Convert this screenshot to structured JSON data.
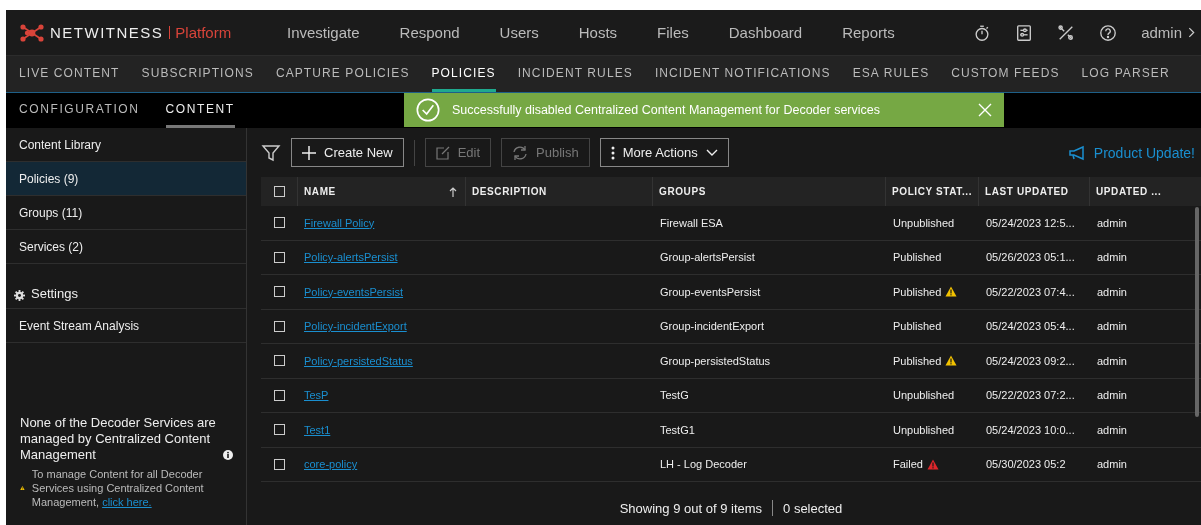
{
  "brand": {
    "name": "NETWITNESS",
    "product": "Platform"
  },
  "nav": [
    {
      "label": "Investigate"
    },
    {
      "label": "Respond"
    },
    {
      "label": "Users"
    },
    {
      "label": "Hosts"
    },
    {
      "label": "Files"
    },
    {
      "label": "Dashboard"
    },
    {
      "label": "Reports"
    }
  ],
  "user": "admin",
  "subnav": [
    {
      "label": "LIVE CONTENT",
      "selected": false
    },
    {
      "label": "SUBSCRIPTIONS",
      "selected": false
    },
    {
      "label": "CAPTURE POLICIES",
      "selected": false
    },
    {
      "label": "POLICIES",
      "selected": true
    },
    {
      "label": "INCIDENT RULES",
      "selected": false
    },
    {
      "label": "INCIDENT NOTIFICATIONS",
      "selected": false
    },
    {
      "label": "ESA RULES",
      "selected": false
    },
    {
      "label": "CUSTOM FEEDS",
      "selected": false
    },
    {
      "label": "LOG PARSER",
      "selected": false
    }
  ],
  "tabs": [
    {
      "label": "CONFIGURATION",
      "selected": false
    },
    {
      "label": "CONTENT",
      "selected": true
    }
  ],
  "sidebar": {
    "items": [
      {
        "label": "Content Library",
        "selected": false
      },
      {
        "label": "Policies (9)",
        "selected": true
      },
      {
        "label": "Groups (11)",
        "selected": false
      },
      {
        "label": "Services (2)",
        "selected": false
      }
    ],
    "settings": {
      "title": "Settings",
      "items": [
        {
          "label": "Event Stream Analysis",
          "selected": false
        }
      ]
    },
    "note": {
      "title": "None of the Decoder Services are managed by Centralized Content Management",
      "text": "To manage Content for all Decoder Services using Centralized Content Management,",
      "link": "click here."
    }
  },
  "toolbar": {
    "create": "Create New",
    "edit": "Edit",
    "publish": "Publish",
    "more": "More Actions",
    "update": "Product Update!"
  },
  "toast": {
    "message": "Successfully disabled Centralized Content Management for Decoder services"
  },
  "table": {
    "columns": [
      {
        "label": "NAME",
        "sorted": true
      },
      {
        "label": "DESCRIPTION"
      },
      {
        "label": "GROUPS"
      },
      {
        "label": "POLICY STAT..."
      },
      {
        "label": "LAST UPDATED"
      },
      {
        "label": "UPDATED ..."
      }
    ],
    "header_checked": false,
    "rows": [
      {
        "checked": false,
        "name": "Firewall Policy",
        "groups": "Firewall ESA",
        "status": "Unpublished",
        "last_updated": "05/24/2023 12:5...",
        "updated_by": "admin"
      },
      {
        "checked": false,
        "name": "Policy-alertsPersist",
        "groups": "Group-alertsPersist",
        "status": "Published",
        "last_updated": "05/26/2023 05:1...",
        "updated_by": "admin"
      },
      {
        "checked": false,
        "name": "Policy-eventsPersist",
        "groups": "Group-eventsPersist",
        "status": "Published",
        "warning": true,
        "last_updated": "05/22/2023 07:4...",
        "updated_by": "admin"
      },
      {
        "checked": false,
        "name": "Policy-incidentExport",
        "groups": "Group-incidentExport",
        "status": "Published",
        "last_updated": "05/24/2023 05:4...",
        "updated_by": "admin"
      },
      {
        "checked": false,
        "name": "Policy-persistedStatus",
        "groups": "Group-persistedStatus",
        "status": "Published",
        "warning": true,
        "last_updated": "05/24/2023 09:2...",
        "updated_by": "admin"
      },
      {
        "checked": false,
        "name": "TesP",
        "groups": "TestG",
        "status": "Unpublished",
        "last_updated": "05/22/2023 07:2...",
        "updated_by": "admin"
      },
      {
        "checked": false,
        "name": "Test1",
        "groups": "TestG1",
        "status": "Unpublished",
        "last_updated": "05/24/2023 10:0...",
        "updated_by": "admin"
      },
      {
        "checked": false,
        "name": "core-policy",
        "groups": "LH - Log Decoder",
        "status": "Failed",
        "error": true,
        "last_updated": "05/30/2023 05:2",
        "updated_by": "admin"
      }
    ]
  },
  "footer": {
    "showing": "Showing 9 out of 9 items",
    "selected": "0 selected"
  }
}
